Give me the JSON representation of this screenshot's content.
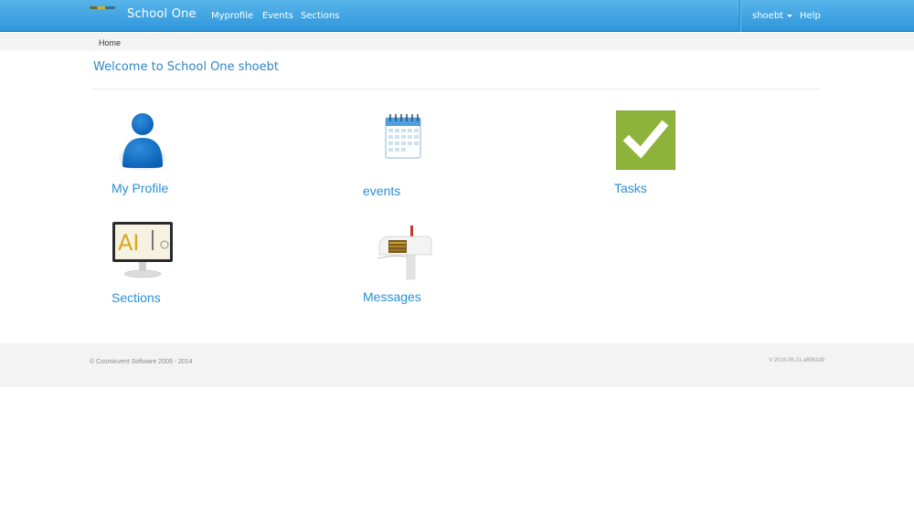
{
  "navbar": {
    "brand": "School One",
    "links": [
      "Myprofile",
      "Events",
      "Sections"
    ],
    "user": "shoebt",
    "help": "Help"
  },
  "breadcrumb": "Home",
  "page_title": "Welcome to School One shoebt",
  "tiles": [
    {
      "label": "My Profile",
      "icon": "user-icon"
    },
    {
      "label": "events",
      "icon": "calendar-icon"
    },
    {
      "label": "Tasks",
      "icon": "checkbox-icon"
    },
    {
      "label": "Sections",
      "icon": "monitor-icon"
    },
    {
      "label": "Messages",
      "icon": "mailbox-icon"
    }
  ],
  "footer": {
    "copyright": "© Cosmicvent Software 2009 - 2014",
    "version": "V 2016.06.21.a6961d9"
  },
  "colors": {
    "navbar": "#2f96db",
    "link": "#2a8fd4",
    "title": "#2d87c8",
    "task_green": "#8db33a"
  }
}
